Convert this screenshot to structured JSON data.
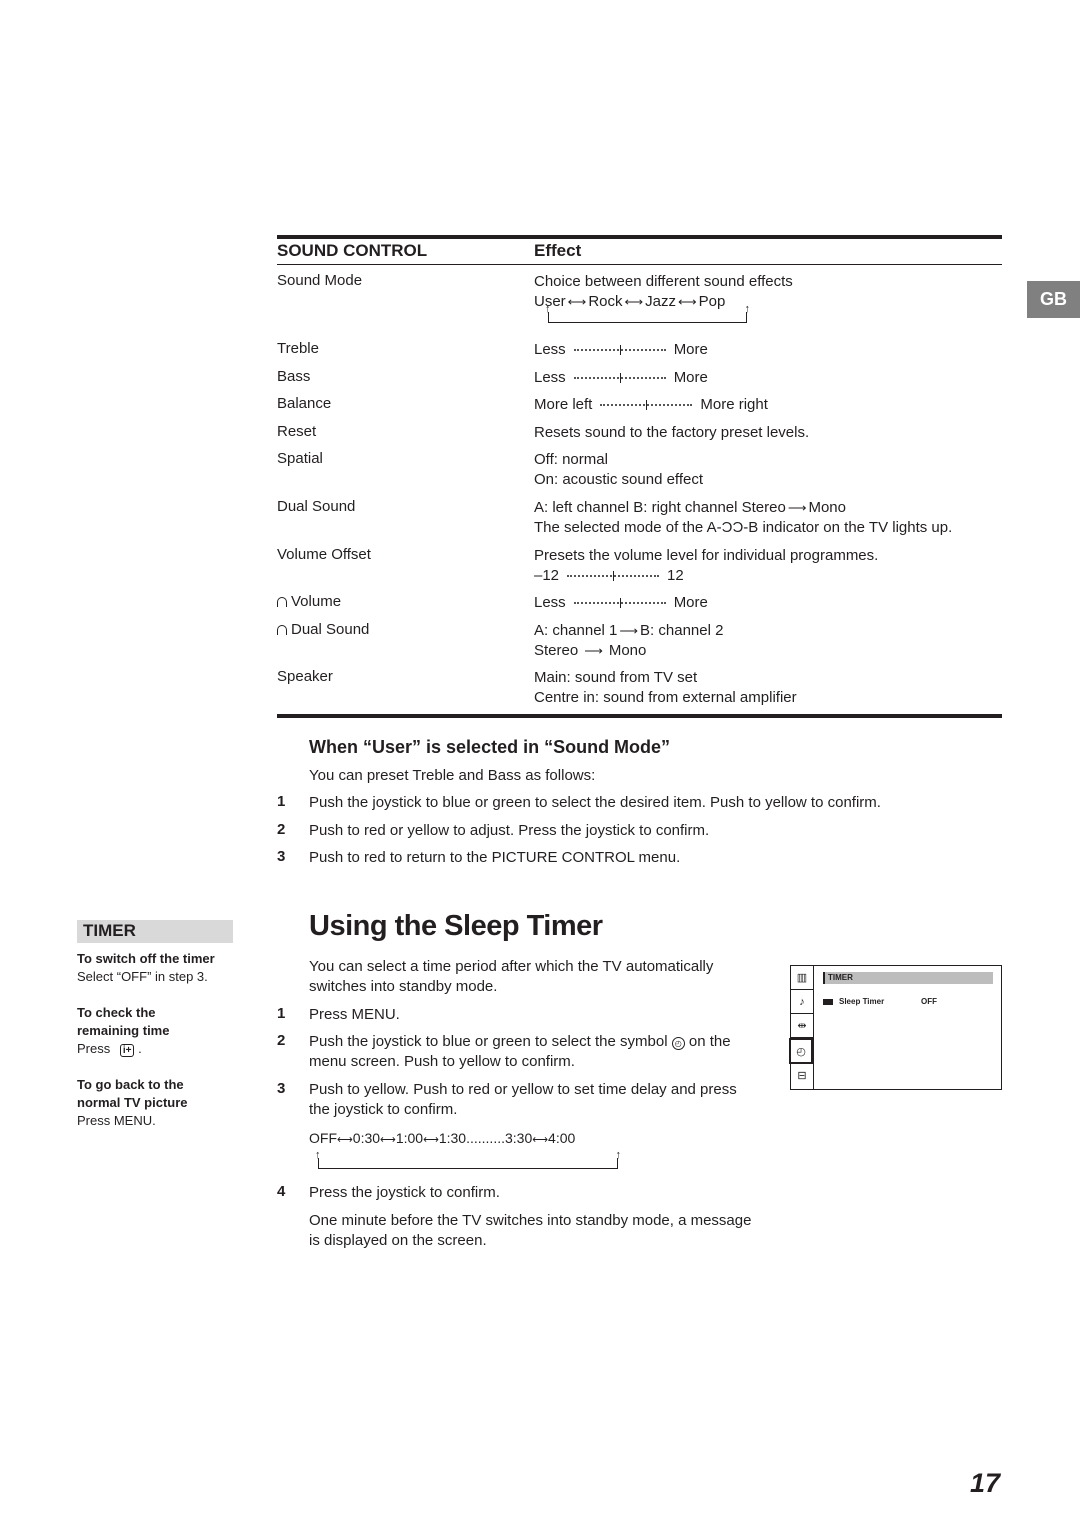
{
  "page_tab": "GB",
  "page_number": "17",
  "sound_control": {
    "header_left": "SOUND CONTROL",
    "header_right": "Effect",
    "rows": [
      {
        "label": "Sound Mode",
        "effect": [
          "Choice between different sound effects"
        ],
        "cycle": [
          "User",
          "Rock",
          "Jazz",
          "Pop"
        ]
      },
      {
        "label": "Treble",
        "slider": {
          "min_label": "Less",
          "max_label": "More"
        }
      },
      {
        "label": "Bass",
        "slider": {
          "min_label": "Less",
          "max_label": "More"
        }
      },
      {
        "label": "Balance",
        "slider": {
          "min_label": "More left",
          "max_label": "More right"
        }
      },
      {
        "label": "Reset",
        "effect": [
          "Resets sound to the factory preset levels."
        ]
      },
      {
        "label": "Spatial",
        "effect": [
          "Off: normal",
          "On: acoustic sound effect"
        ]
      },
      {
        "label": "Dual Sound",
        "effect": [
          "A: left channel  B: right channel   Stereo",
          "Mono",
          "The selected mode of the A-ƆƆ-B indicator on the TV lights up."
        ]
      },
      {
        "label": "Volume Offset",
        "effect": [
          "Presets the volume level for individual programmes."
        ],
        "slider": {
          "min_label": "–12",
          "max_label": "12"
        }
      },
      {
        "label": "Volume",
        "icon": "headphones-icon",
        "slider": {
          "min_label": "Less",
          "max_label": "More"
        }
      },
      {
        "label": "Dual Sound",
        "icon": "headphones-icon",
        "effect": [
          "A: channel 1",
          "B: channel 2",
          "Stereo",
          "Mono"
        ]
      },
      {
        "label": "Speaker",
        "effect": [
          "Main: sound from TV set",
          "Centre in: sound from external amplifier"
        ]
      }
    ]
  },
  "user_section": {
    "title": "When “User” is selected in “Sound Mode”",
    "intro": "You can preset Treble and Bass as follows:",
    "steps": [
      {
        "num": "1",
        "text": "Push the joystick to blue or green to select the desired item.  Push to yellow to confirm."
      },
      {
        "num": "2",
        "text": "Push to red or yellow to adjust.  Press the joystick to confirm."
      },
      {
        "num": "3",
        "text": "Push to red to return to the PICTURE CONTROL menu."
      }
    ]
  },
  "sleep_timer": {
    "title": "Using the Sleep Timer",
    "intro": [
      "You can select a time period after which the TV automatically",
      "switches into standby mode."
    ],
    "steps": [
      {
        "num": "1",
        "lines": [
          "Press MENU."
        ]
      },
      {
        "num": "2",
        "lines": [
          "Push the joystick to blue or green to select the symbol",
          "on the",
          "menu screen.  Push to yellow to confirm."
        ]
      },
      {
        "num": "3",
        "lines": [
          "Push to yellow.  Push to red or yellow to set time delay and press",
          "the joystick to confirm."
        ]
      },
      {
        "num": "4",
        "lines": [
          "Press the joystick to confirm."
        ]
      }
    ],
    "cycle": [
      "OFF",
      "0:30",
      "1:00",
      "1:30",
      "..........3:30",
      "4:00"
    ],
    "outro": [
      "One minute before the TV switches into standby mode, a message",
      "is displayed on the screen."
    ]
  },
  "sidebar": {
    "label": "TIMER",
    "items": [
      {
        "heading": [
          "To switch off the timer"
        ],
        "text": "Select “OFF” in step 3."
      },
      {
        "heading": [
          "To check the",
          "remaining time"
        ],
        "text": "Press",
        "button": "i+"
      },
      {
        "heading": [
          "To go back to the",
          "normal TV picture"
        ],
        "text": "Press MENU."
      }
    ]
  },
  "tv_menu": {
    "title": "TIMER",
    "item_label": "Sleep Timer",
    "item_value": "OFF",
    "icons": [
      "picture-icon",
      "sound-note-icon",
      "screen-size-icon",
      "clock-icon",
      "preset-icon"
    ],
    "selected_icon": "clock-icon"
  }
}
